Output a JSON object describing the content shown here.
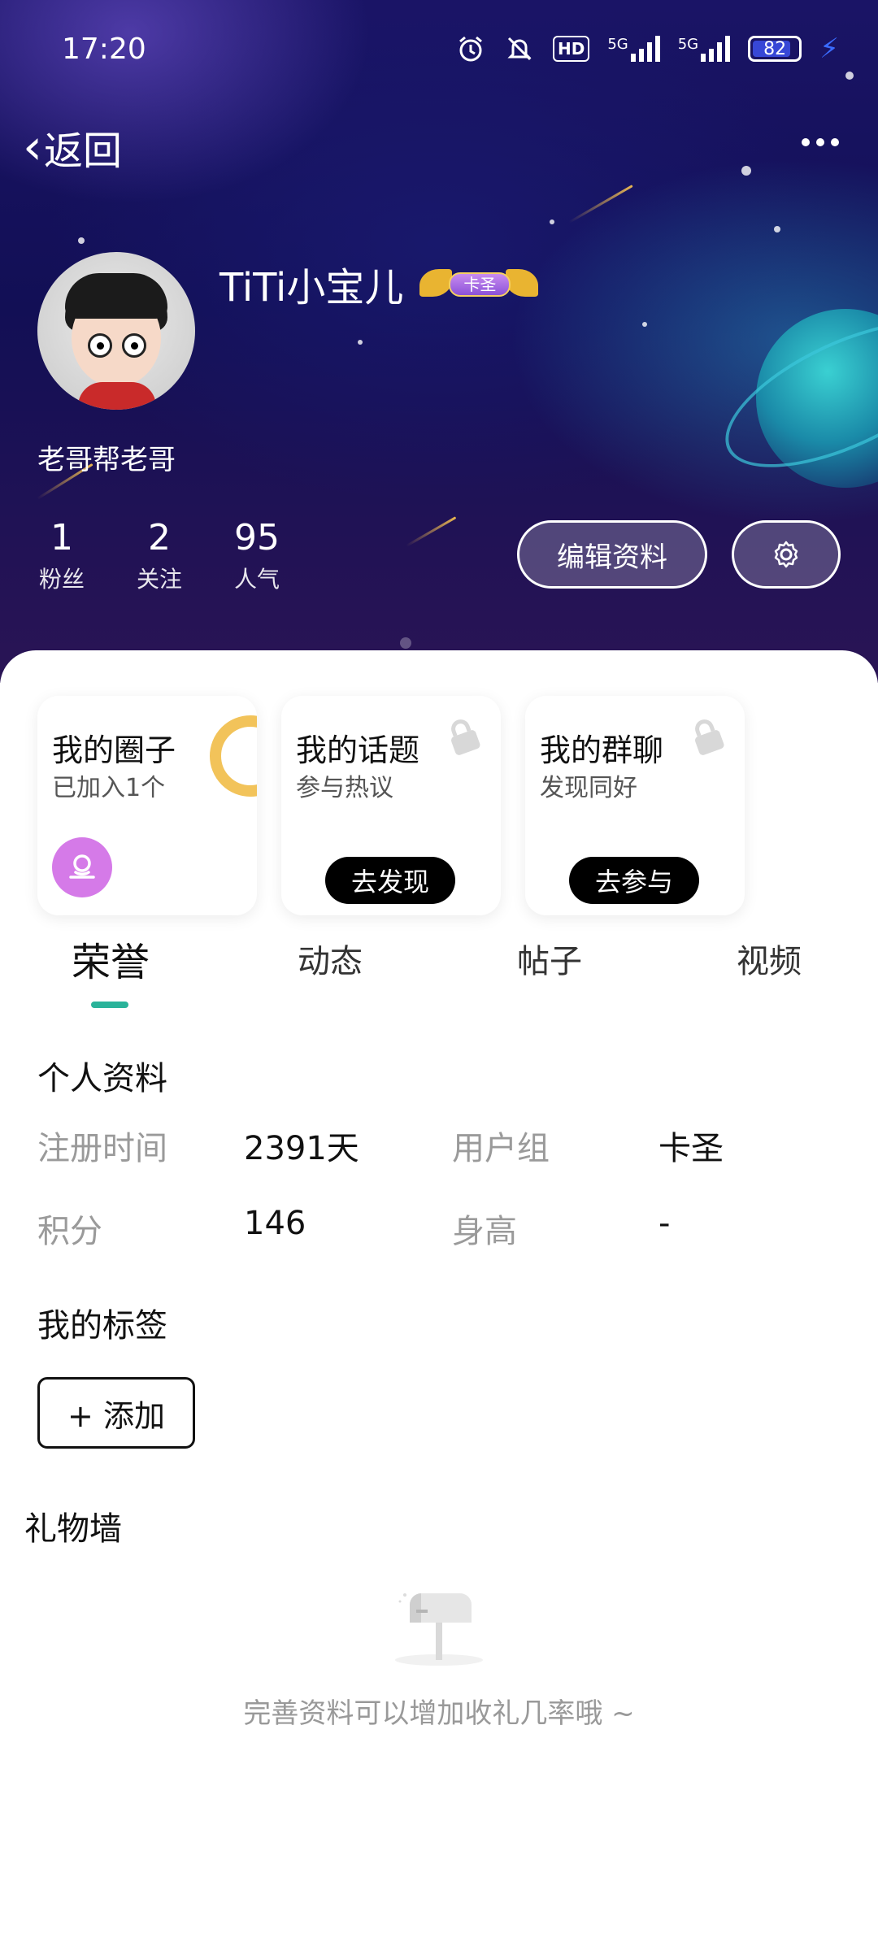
{
  "status_bar": {
    "time": "17:20",
    "network_1": "5G",
    "network_2": "5G",
    "hd_label": "HD",
    "battery": "82",
    "icons": [
      "alarm-icon",
      "mute-icon",
      "hd-icon",
      "signal-5g-icon",
      "signal-5g-icon",
      "battery-icon",
      "charging-icon"
    ]
  },
  "nav": {
    "back_label": "返回",
    "more_icon": "more-icon"
  },
  "profile": {
    "username": "TiTi小宝儿",
    "rank_badge": "卡圣",
    "signature": "老哥帮老哥",
    "stats": [
      {
        "value": "1",
        "label": "粉丝"
      },
      {
        "value": "2",
        "label": "关注"
      },
      {
        "value": "95",
        "label": "人气"
      }
    ],
    "edit_button": "编辑资料"
  },
  "features": [
    {
      "title": "我的圈子",
      "subtitle": "已加入1个"
    },
    {
      "title": "我的话题",
      "subtitle": "参与热议",
      "button": "去发现"
    },
    {
      "title": "我的群聊",
      "subtitle": "发现同好",
      "button": "去参与"
    }
  ],
  "tabs": [
    {
      "label": "荣誉",
      "active": true
    },
    {
      "label": "动态",
      "active": false
    },
    {
      "label": "帖子",
      "active": false
    },
    {
      "label": "视频",
      "active": false
    }
  ],
  "personal_info": {
    "title": "个人资料",
    "fields": [
      {
        "key": "注册时间",
        "value": "2391天"
      },
      {
        "key": "用户组",
        "value": "卡圣"
      },
      {
        "key": "积分",
        "value": "146"
      },
      {
        "key": "身高",
        "value": "-"
      }
    ]
  },
  "tags": {
    "title": "我的标签",
    "add_button": "+ 添加"
  },
  "gift_wall": {
    "title": "礼物墙",
    "empty_text": "完善资料可以增加收礼几率哦 ~"
  },
  "colors": {
    "accent": "#2ab39a",
    "header_bg": "#140f5a",
    "battery_fill": "#3747d6"
  }
}
